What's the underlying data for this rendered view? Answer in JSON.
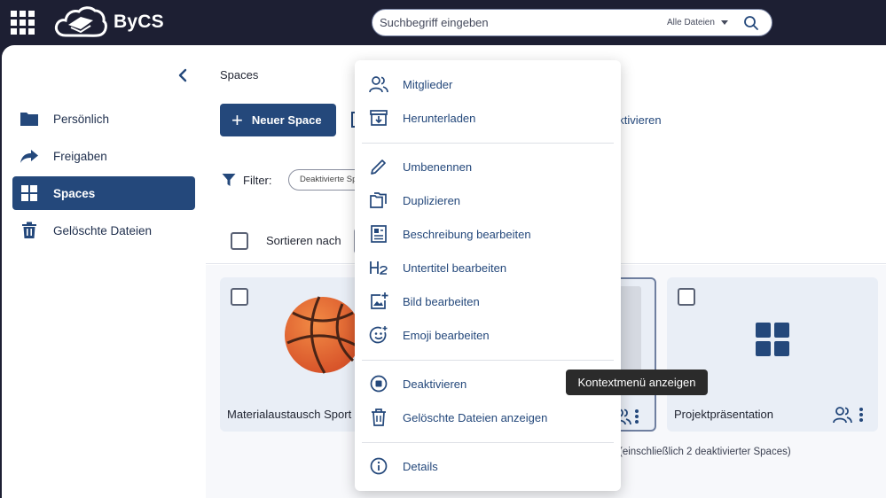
{
  "header": {
    "logo_text": "ByCS",
    "search": {
      "placeholder": "Suchbegriff eingeben",
      "scope": "Alle Dateien"
    }
  },
  "sidebar": {
    "items": [
      {
        "label": "Persönlich",
        "icon": "folder-icon",
        "active": false
      },
      {
        "label": "Freigaben",
        "icon": "share-arrow-icon",
        "active": false
      },
      {
        "label": "Spaces",
        "icon": "spaces-grid-icon",
        "active": true
      },
      {
        "label": "Gelöschte Dateien",
        "icon": "trash-icon",
        "active": false
      }
    ]
  },
  "main": {
    "title": "Spaces",
    "new_space_label": "Neuer Space",
    "deactivate_label": "aktivieren",
    "filter_label": "Filter:",
    "filter_chip": "Deaktivierte Spaces",
    "sort_label": "Sortieren nach",
    "count_text": "(einschließlich 2 deaktivierter Spaces)",
    "cards": [
      {
        "title": "Materialaustausch Sport",
        "image": "basketball-emoji"
      },
      {
        "title": "",
        "image": "placeholder"
      },
      {
        "title": "Projektpräsentation",
        "image": "spaces-grid-icon"
      }
    ]
  },
  "context_menu": {
    "items": [
      {
        "label": "Mitglieder",
        "icon": "members-icon"
      },
      {
        "label": "Herunterladen",
        "icon": "download-icon"
      },
      {
        "label": "Umbenennen",
        "icon": "pencil-icon"
      },
      {
        "label": "Duplizieren",
        "icon": "duplicate-icon"
      },
      {
        "label": "Beschreibung bearbeiten",
        "icon": "description-icon"
      },
      {
        "label": "Untertitel bearbeiten",
        "icon": "heading-icon"
      },
      {
        "label": "Bild bearbeiten",
        "icon": "image-add-icon"
      },
      {
        "label": "Emoji bearbeiten",
        "icon": "emoji-icon"
      },
      {
        "label": "Deaktivieren",
        "icon": "stop-circle-icon"
      },
      {
        "label": "Gelöschte Dateien anzeigen",
        "icon": "trash-icon"
      },
      {
        "label": "Details",
        "icon": "info-icon"
      }
    ]
  },
  "tooltip": {
    "text": "Kontextmenü anzeigen"
  },
  "colors": {
    "topbar": "#1d1f33",
    "accent": "#24487b",
    "card_bg": "#e9eef6"
  }
}
